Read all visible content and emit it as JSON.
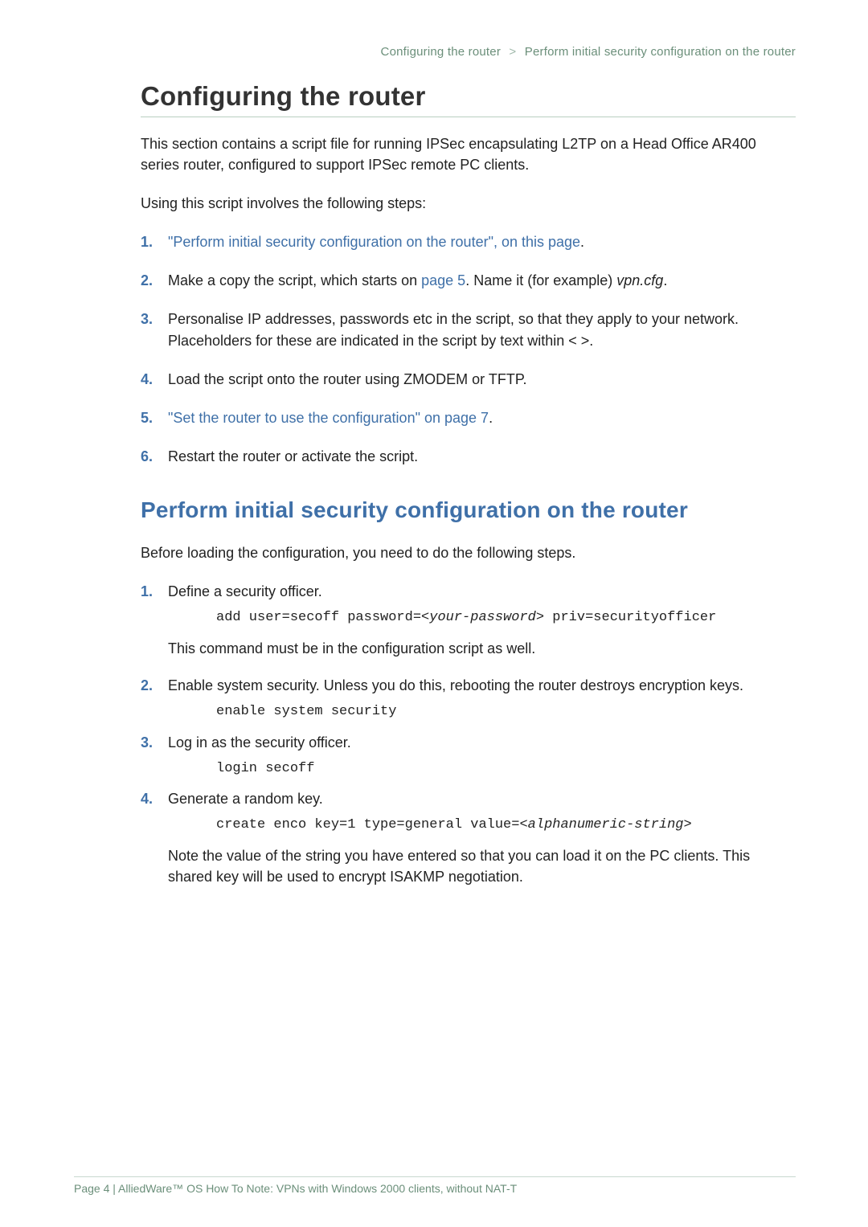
{
  "breadcrumb": {
    "part1": "Configuring the router",
    "sep": ">",
    "part2": "Perform initial security configuration on the router"
  },
  "title": "Configuring the router",
  "intro1": "This section contains a script file for running IPSec encapsulating L2TP on a Head Office AR400 series router, configured to support IPSec remote PC clients.",
  "intro2": "Using this script involves the following steps:",
  "steps_a": {
    "s1_link": "\"Perform initial security configuration on the router\", on this page",
    "s1_tail": ".",
    "s2_pre": "Make a copy the script, which starts on ",
    "s2_link": "page 5",
    "s2_mid": ". Name it (for example) ",
    "s2_file": "vpn.cfg",
    "s2_tail": ".",
    "s3": "Personalise IP addresses, passwords etc in the script, so that they apply to your network. Placeholders for these are indicated in the script by text within <  >.",
    "s4": "Load the script onto the router using ZMODEM or TFTP.",
    "s5_link": "\"Set the router to use the configuration\" on page 7",
    "s5_tail": ".",
    "s6": "Restart the router or activate the script."
  },
  "h2": "Perform initial security configuration on the router",
  "before": "Before loading the configuration, you need to do the following steps.",
  "steps_b": {
    "s1": "Define a security officer.",
    "s1_code_pre": "add user=secoff password=<",
    "s1_code_ital": "your-password",
    "s1_code_post": "> priv=securityofficer",
    "s1_after": "This command must be in the configuration script as well.",
    "s2": "Enable system security. Unless you do this, rebooting the router destroys encryption keys.",
    "s2_code": "enable system security",
    "s3": "Log in as the security officer.",
    "s3_code": "login secoff",
    "s4": "Generate a random key.",
    "s4_code_pre": "create enco key=1 type=general value=<",
    "s4_code_ital": "alphanumeric-string",
    "s4_code_post": ">",
    "s4_after": "Note the value of the string you have entered so that you can load it on the PC clients. This shared key will be used to encrypt ISAKMP negotiation."
  },
  "footer": "Page 4 | AlliedWare™ OS How To Note: VPNs with Windows 2000 clients, without NAT-T"
}
